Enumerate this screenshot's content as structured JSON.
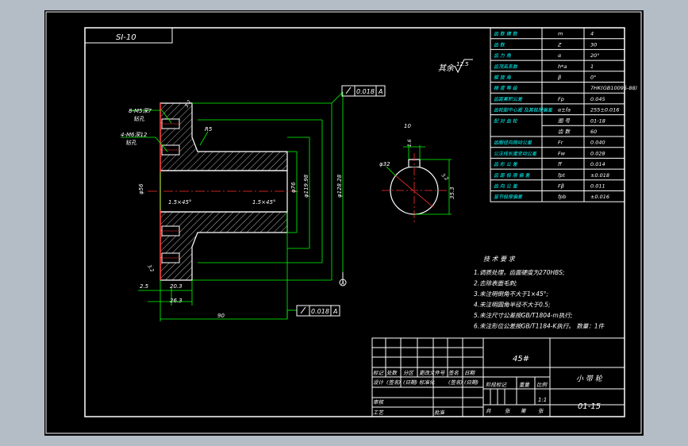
{
  "drawing": {
    "code_top": "SI-10",
    "roughness_note": "其余",
    "roughness_value": "12.5"
  },
  "gear_table": [
    {
      "label": "齿 数 模 数",
      "sym": "m",
      "val": "4"
    },
    {
      "label": "齿 数",
      "sym": "Z",
      "val": "30"
    },
    {
      "label": "齿 力 角",
      "sym": "α",
      "val": "20°"
    },
    {
      "label": "齿顶高系数",
      "sym": "h*a",
      "val": "1"
    },
    {
      "label": "螺 旋 角",
      "sym": "β",
      "val": "0°"
    },
    {
      "label": "精 度 等 级",
      "sym": "",
      "val": "7HK(GB10095-88)"
    },
    {
      "label": "齿距累积公差",
      "sym": "Fp",
      "val": "0.045"
    },
    {
      "label": "齿轮副中心距 及其极限偏差",
      "sym": "α±fa",
      "val": "255±0.016"
    },
    {
      "label": "配 对 齿 轮",
      "sym": "图 号",
      "val": "01-18"
    },
    {
      "label": "",
      "sym": "齿 数",
      "val": "60"
    },
    {
      "label": "齿圈径向跳动公差",
      "sym": "Fr",
      "val": "0.040"
    },
    {
      "label": "公法线长度变动公差",
      "sym": "Fw",
      "val": "0.028"
    },
    {
      "label": "齿 形 公 差",
      "sym": "ff",
      "val": "0.014"
    },
    {
      "label": "齿 距 极 限 偏 差",
      "sym": "fpt",
      "val": "±0.018"
    },
    {
      "label": "齿 向 公 差",
      "sym": "Fβ",
      "val": "0.011"
    },
    {
      "label": "基节极限偏差",
      "sym": "fpb",
      "val": "±0.016"
    }
  ],
  "tech_req": {
    "title": "技 术 要 求",
    "items": [
      "1.调质处理，齿面硬度为270HBS;",
      "2.去除表面毛刺;",
      "3.未注明倒角不大于1×45°;",
      "4.未注明圆角半径不大于0.5;",
      "5.未注尺寸公差按GB/T1804-m执行;",
      "6.未注形位公差按GB/T1184-K执行。    数量：1件"
    ]
  },
  "dims": {
    "tol1": "0.018",
    "datum": "A",
    "tol2": "0.018",
    "thread1": "8-M5深7",
    "thread1b": "钻孔",
    "thread2": "4-M6深12",
    "thread2b": "钻孔",
    "r5": "R5",
    "d56": "φ56",
    "d76": "φ76",
    "d119": "φ119.98",
    "d128": "φ128.28",
    "chamfer1": "1.5×45°",
    "chamfer2": "1.5×45°",
    "d2_5": "2.5",
    "d20_3": "20.3",
    "d26_3": "26.3",
    "d90": "90",
    "d32": "φ32",
    "d10": "10",
    "d35": "35.3",
    "rough_a": "3.2",
    "rough_b": "3.2",
    "rough_c": "1.6",
    "rough_d": "3.2"
  },
  "title_block": {
    "material": "45#",
    "part_name": "小 带 轮",
    "drawing_no": "01-15",
    "scale": "1:1",
    "labels": {
      "biaoji": "标记",
      "chushu": "处数",
      "fenqu": "分区",
      "genggai": "更改文件号",
      "qianming": "签名",
      "riqi": "日期",
      "sheji": "设计",
      "qianming2": "(签名)",
      "riqi2": "(日期)",
      "biaozhunhua": "标准化",
      "qianming3": "(签名)",
      "riqi3": "(日期)",
      "jieduan": "阶段标记",
      "zhongliang": "重量",
      "bili": "比例",
      "shenhe": "审核",
      "gongyi": "工艺",
      "pizhun": "批准",
      "gong": "共",
      "zhang": "张",
      "di": "第",
      "zhang2": "张"
    }
  }
}
